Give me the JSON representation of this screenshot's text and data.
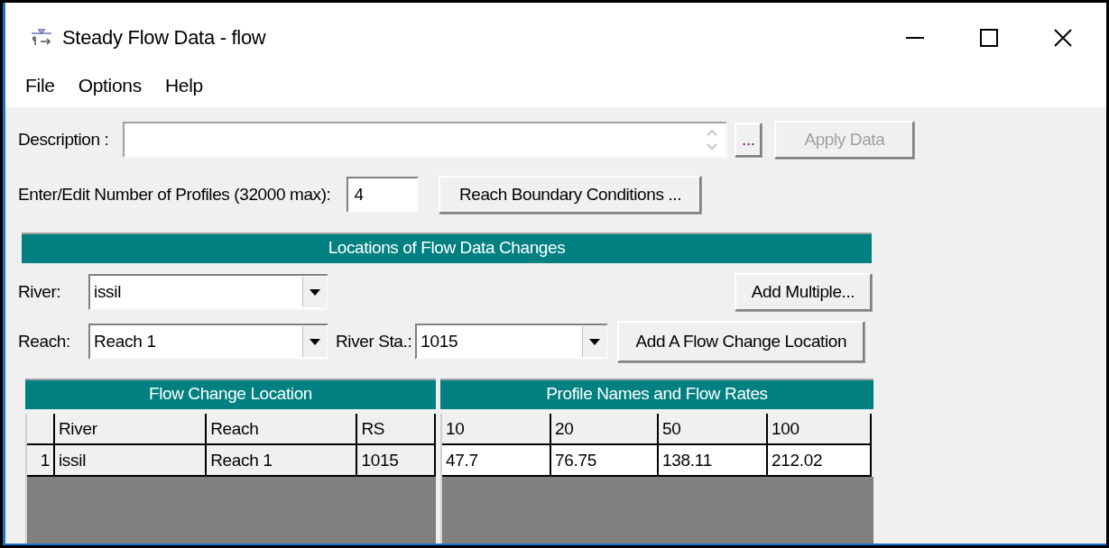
{
  "window": {
    "title": "Steady Flow Data - flow"
  },
  "menu": [
    "File",
    "Options",
    "Help"
  ],
  "description": {
    "label": "Description :"
  },
  "buttons": {
    "browse": {
      "label": "...",
      "disabled": false
    },
    "apply": {
      "label": "Apply Data",
      "disabled": true
    },
    "boundary": {
      "label": "Reach Boundary Conditions ...",
      "disabled": false
    },
    "add_multiple": {
      "label": "Add Multiple...",
      "disabled": false
    },
    "add_location": {
      "label": "Add A Flow Change Location",
      "disabled": false
    }
  },
  "profiles": {
    "label": "Enter/Edit Number of Profiles (32000 max):",
    "value": "4"
  },
  "locations": {
    "title": "Locations of Flow Data Changes",
    "river": {
      "label": "River:",
      "value": "issil"
    },
    "reach": {
      "label": "Reach:",
      "value": "Reach 1"
    },
    "river_station": {
      "label": "River Sta.:",
      "value": "1015"
    }
  },
  "table": {
    "groups": [
      "Flow Change Location",
      "Profile Names and Flow Rates"
    ],
    "location_columns": [
      "River",
      "Reach",
      "RS"
    ],
    "profile_columns": [
      "10",
      "20",
      "50",
      "100"
    ],
    "rows": [
      {
        "number": "1",
        "location": [
          "issil",
          "Reach 1",
          "1015"
        ],
        "flows": [
          "47.7",
          "76.75",
          "138.11",
          "212.02"
        ]
      }
    ]
  }
}
